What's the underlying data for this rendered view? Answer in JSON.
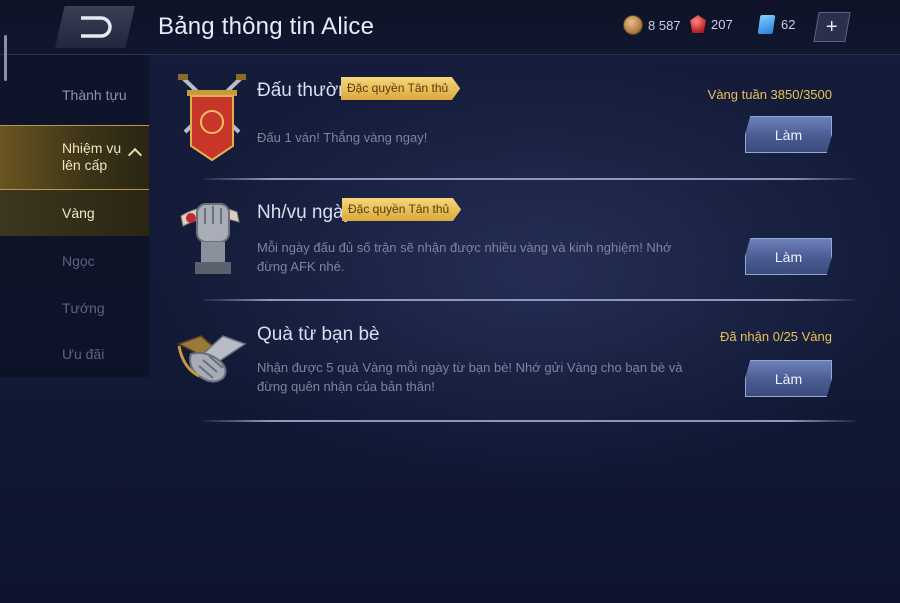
{
  "header": {
    "title": "Bảng thông tin Alice",
    "currencies": [
      {
        "icon": "coin-icon",
        "value": "8 587"
      },
      {
        "icon": "ruby-icon",
        "value": "207"
      },
      {
        "icon": "voucher-icon",
        "value": "62"
      }
    ],
    "plus_label": "+"
  },
  "sidebar": {
    "items": [
      {
        "label": "Thành tựu"
      },
      {
        "label": "Nhiệm vụ lên cấp"
      },
      {
        "label": "Vàng"
      },
      {
        "label": "Ngọc"
      },
      {
        "label": "Tướng"
      },
      {
        "label": "Ưu đãi"
      }
    ]
  },
  "tasks": [
    {
      "icon": "banner-swords-icon",
      "title": "Đấu thường",
      "badge": "Đặc quyền Tân thủ",
      "description": "Đấu 1 ván! Thắng vàng ngay!",
      "status": "Vàng tuần 3850/3500",
      "button": "Làm"
    },
    {
      "icon": "fist-scroll-icon",
      "title": "Nh/vụ ngày",
      "badge": "Đặc quyền Tân thủ",
      "description": "Mỗi ngày đấu đủ số trận sẽ nhận được nhiều vàng và kinh nghiệm! Nhớ đừng AFK nhé.",
      "status": "",
      "button": "Làm"
    },
    {
      "icon": "handshake-icon",
      "title": "Quà từ bạn bè",
      "badge": "",
      "description": "Nhận được 5 quà Vàng mỗi ngày từ bạn bè! Nhớ gửi Vàng cho bạn bè và đừng quên nhận của bản thân!",
      "status": "Đã nhận 0/25 Vàng",
      "button": "Làm"
    }
  ]
}
